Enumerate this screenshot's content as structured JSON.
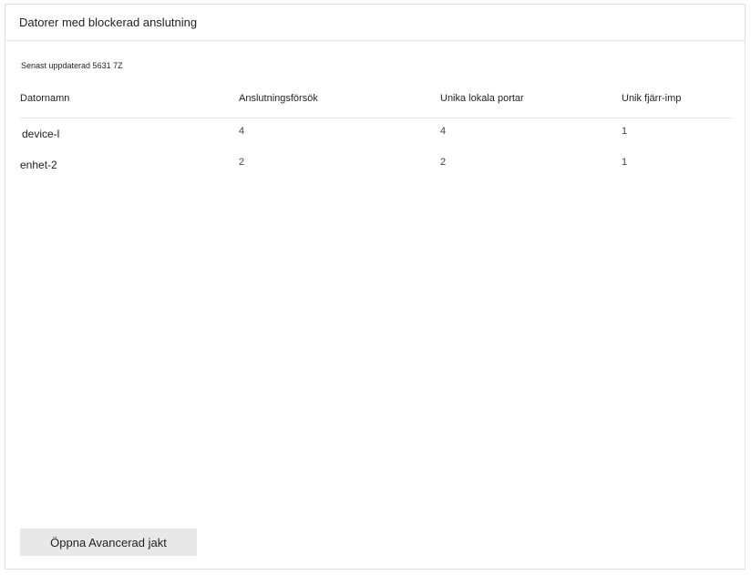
{
  "card": {
    "title": "Datorer med blockerad anslutning",
    "last_updated": "Senast uppdaterad 5631 7Z"
  },
  "table": {
    "columns": [
      "Datornamn",
      "Anslutningsförsök",
      "Unika lokala portar",
      "Unik fjärr-imp"
    ],
    "rows": [
      {
        "name": "device-l",
        "attempts": "4",
        "local_ports": "4",
        "remote": "1"
      },
      {
        "name": "enhet-2",
        "attempts": "2",
        "local_ports": "2",
        "remote": "1"
      }
    ]
  },
  "actions": {
    "advanced_hunting_label": "Öppna Avancerad jakt"
  }
}
